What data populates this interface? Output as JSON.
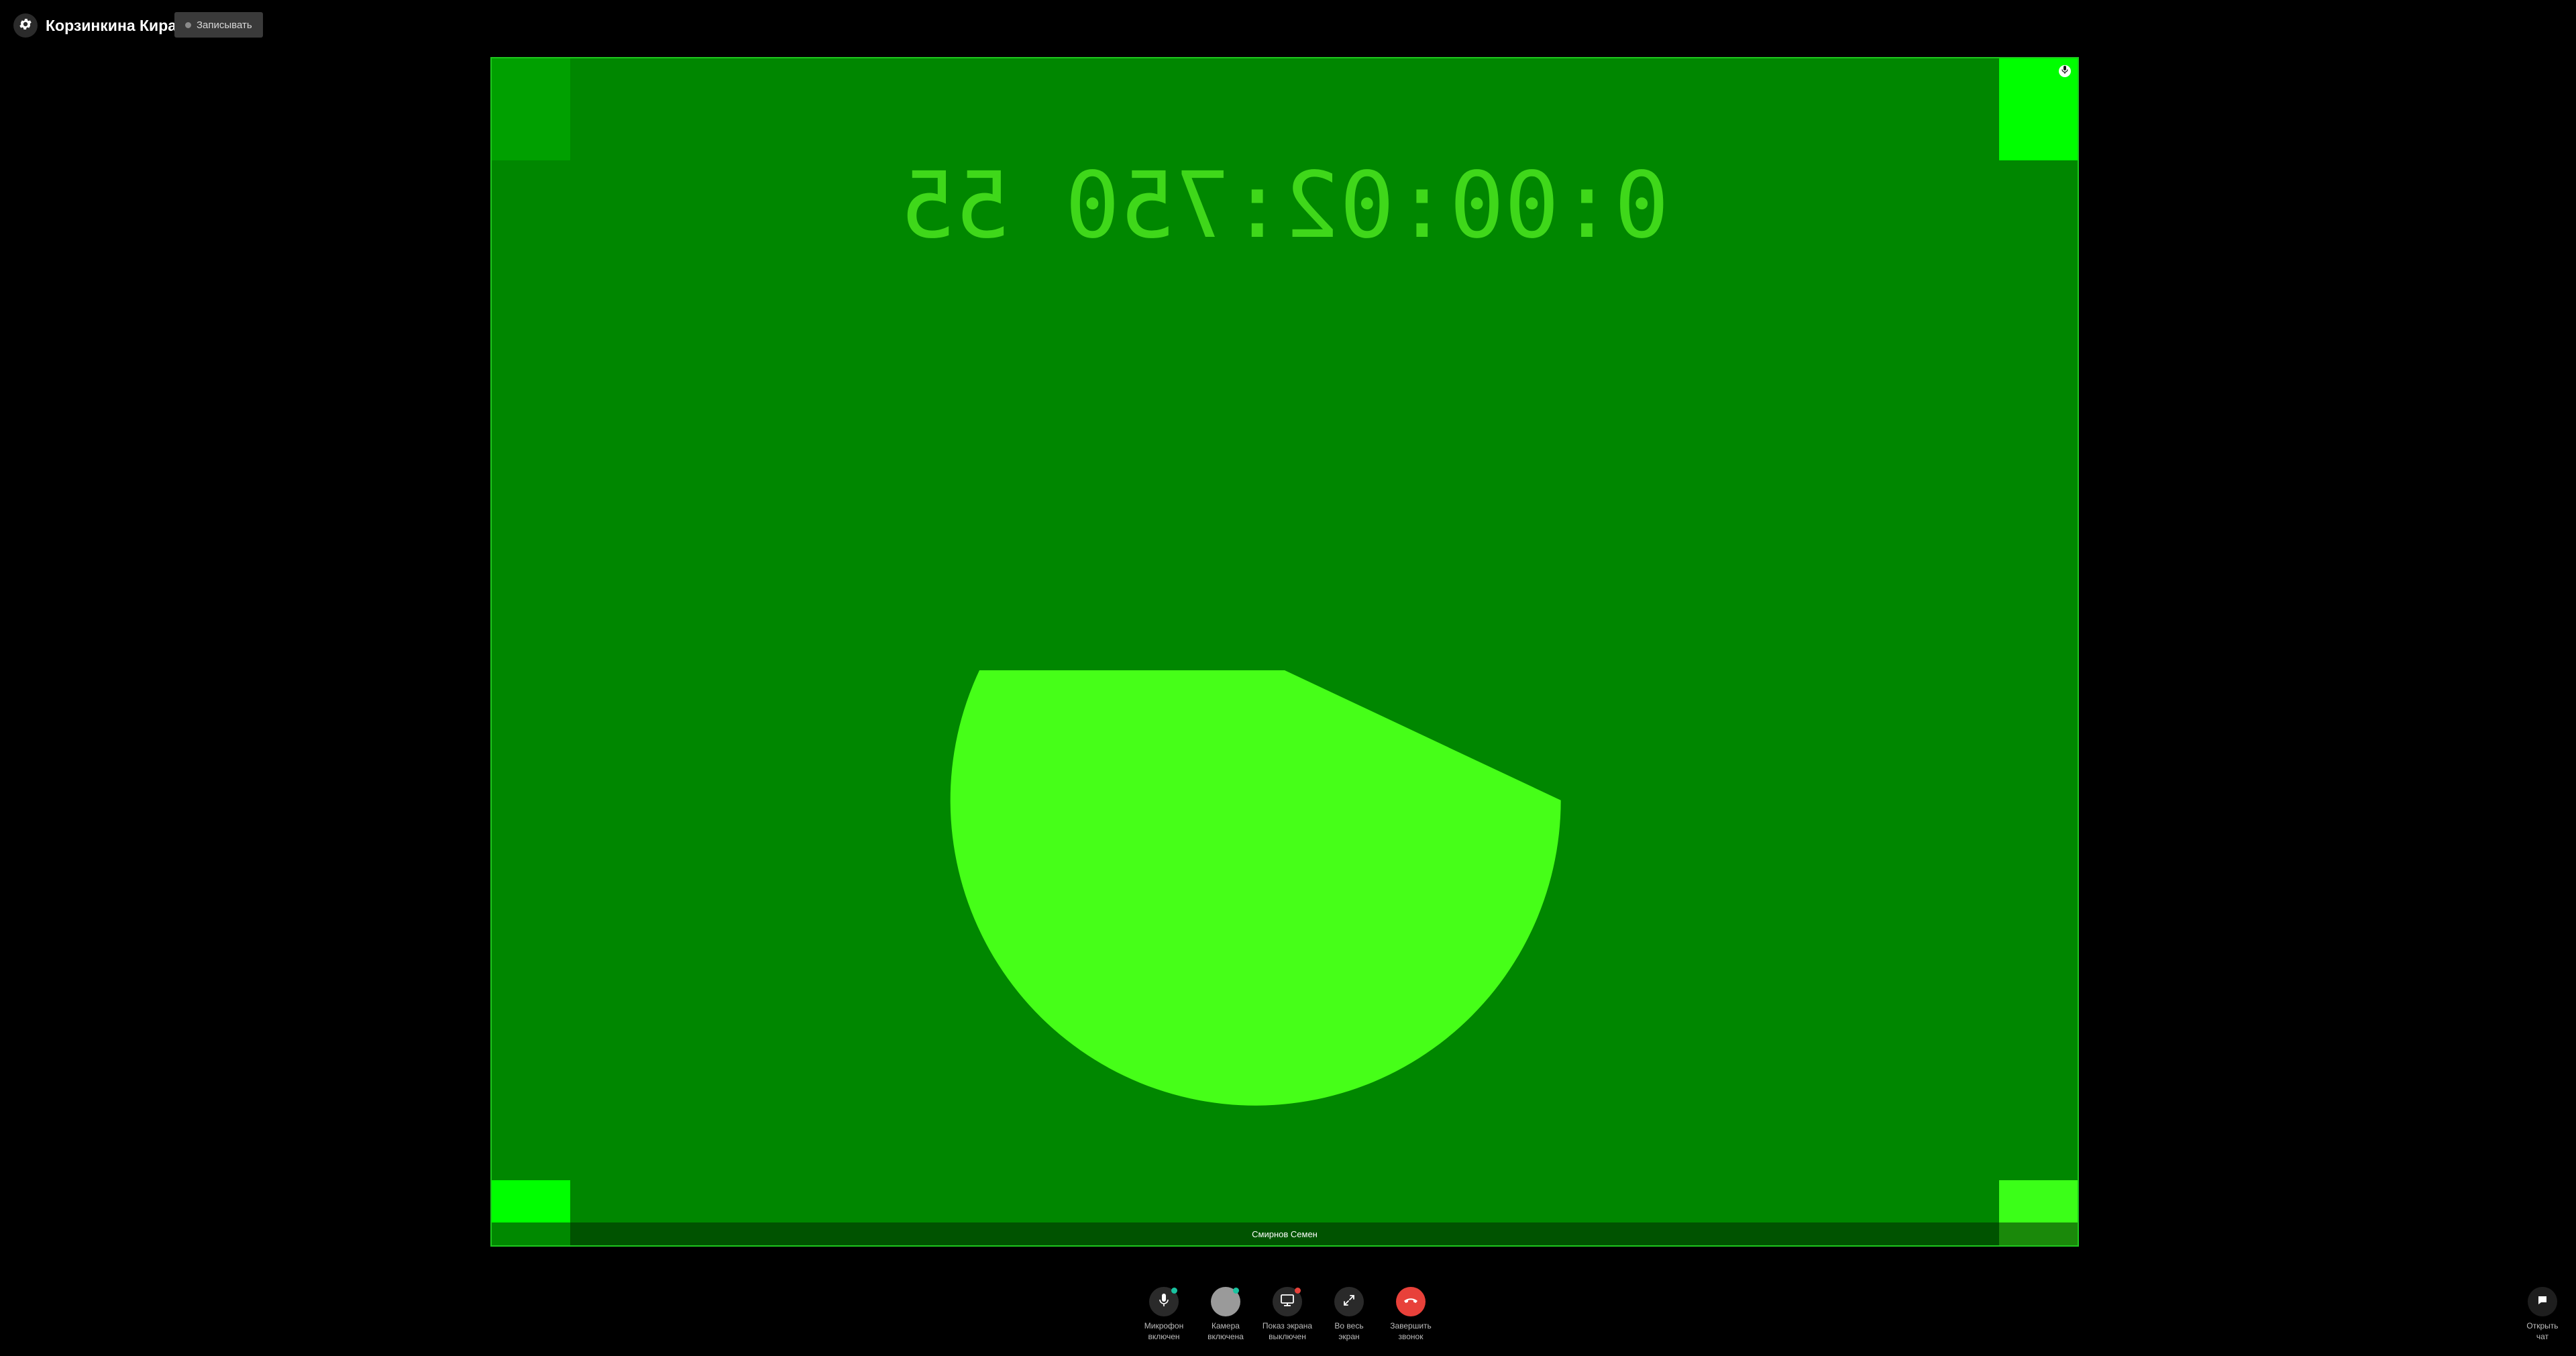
{
  "header": {
    "title": "Корзинкина Кира",
    "record_label": "Записывать",
    "settings_icon": "gear-icon"
  },
  "video": {
    "participant_name": "Смирнов Семен",
    "timecode_text": "0:00:02:750 55",
    "timecode_mirrored": true,
    "progress_fraction": 0.57,
    "colors": {
      "background": "#008700",
      "border": "#1fc71f",
      "pie": "#46ff18",
      "timecode": "#3fd81a",
      "corner_top_left": "#00a000",
      "corner_top_right": "#00ff00",
      "corner_bottom_left": "#00ff00",
      "corner_bottom_right": "#3bff18"
    },
    "mic_indicator_icon": "microphone-icon"
  },
  "controls": [
    {
      "id": "mic",
      "label": "Микрофон\nвключен",
      "icon": "microphone-icon",
      "status_color": "#19c3a0"
    },
    {
      "id": "camera",
      "label": "Камера\nвключена",
      "icon": "camera-icon",
      "status_color": "#19c3a0"
    },
    {
      "id": "screen",
      "label": "Показ экрана\nвыключен",
      "icon": "screen-share-icon",
      "status_color": "#e8413a"
    },
    {
      "id": "fullscreen",
      "label": "Во весь\nэкран",
      "icon": "fullscreen-icon",
      "status_color": ""
    },
    {
      "id": "hangup",
      "label": "Завершить\nзвонок",
      "icon": "hangup-icon",
      "status_color": ""
    }
  ],
  "chat": {
    "label": "Открыть\nчат",
    "icon": "chat-icon"
  }
}
